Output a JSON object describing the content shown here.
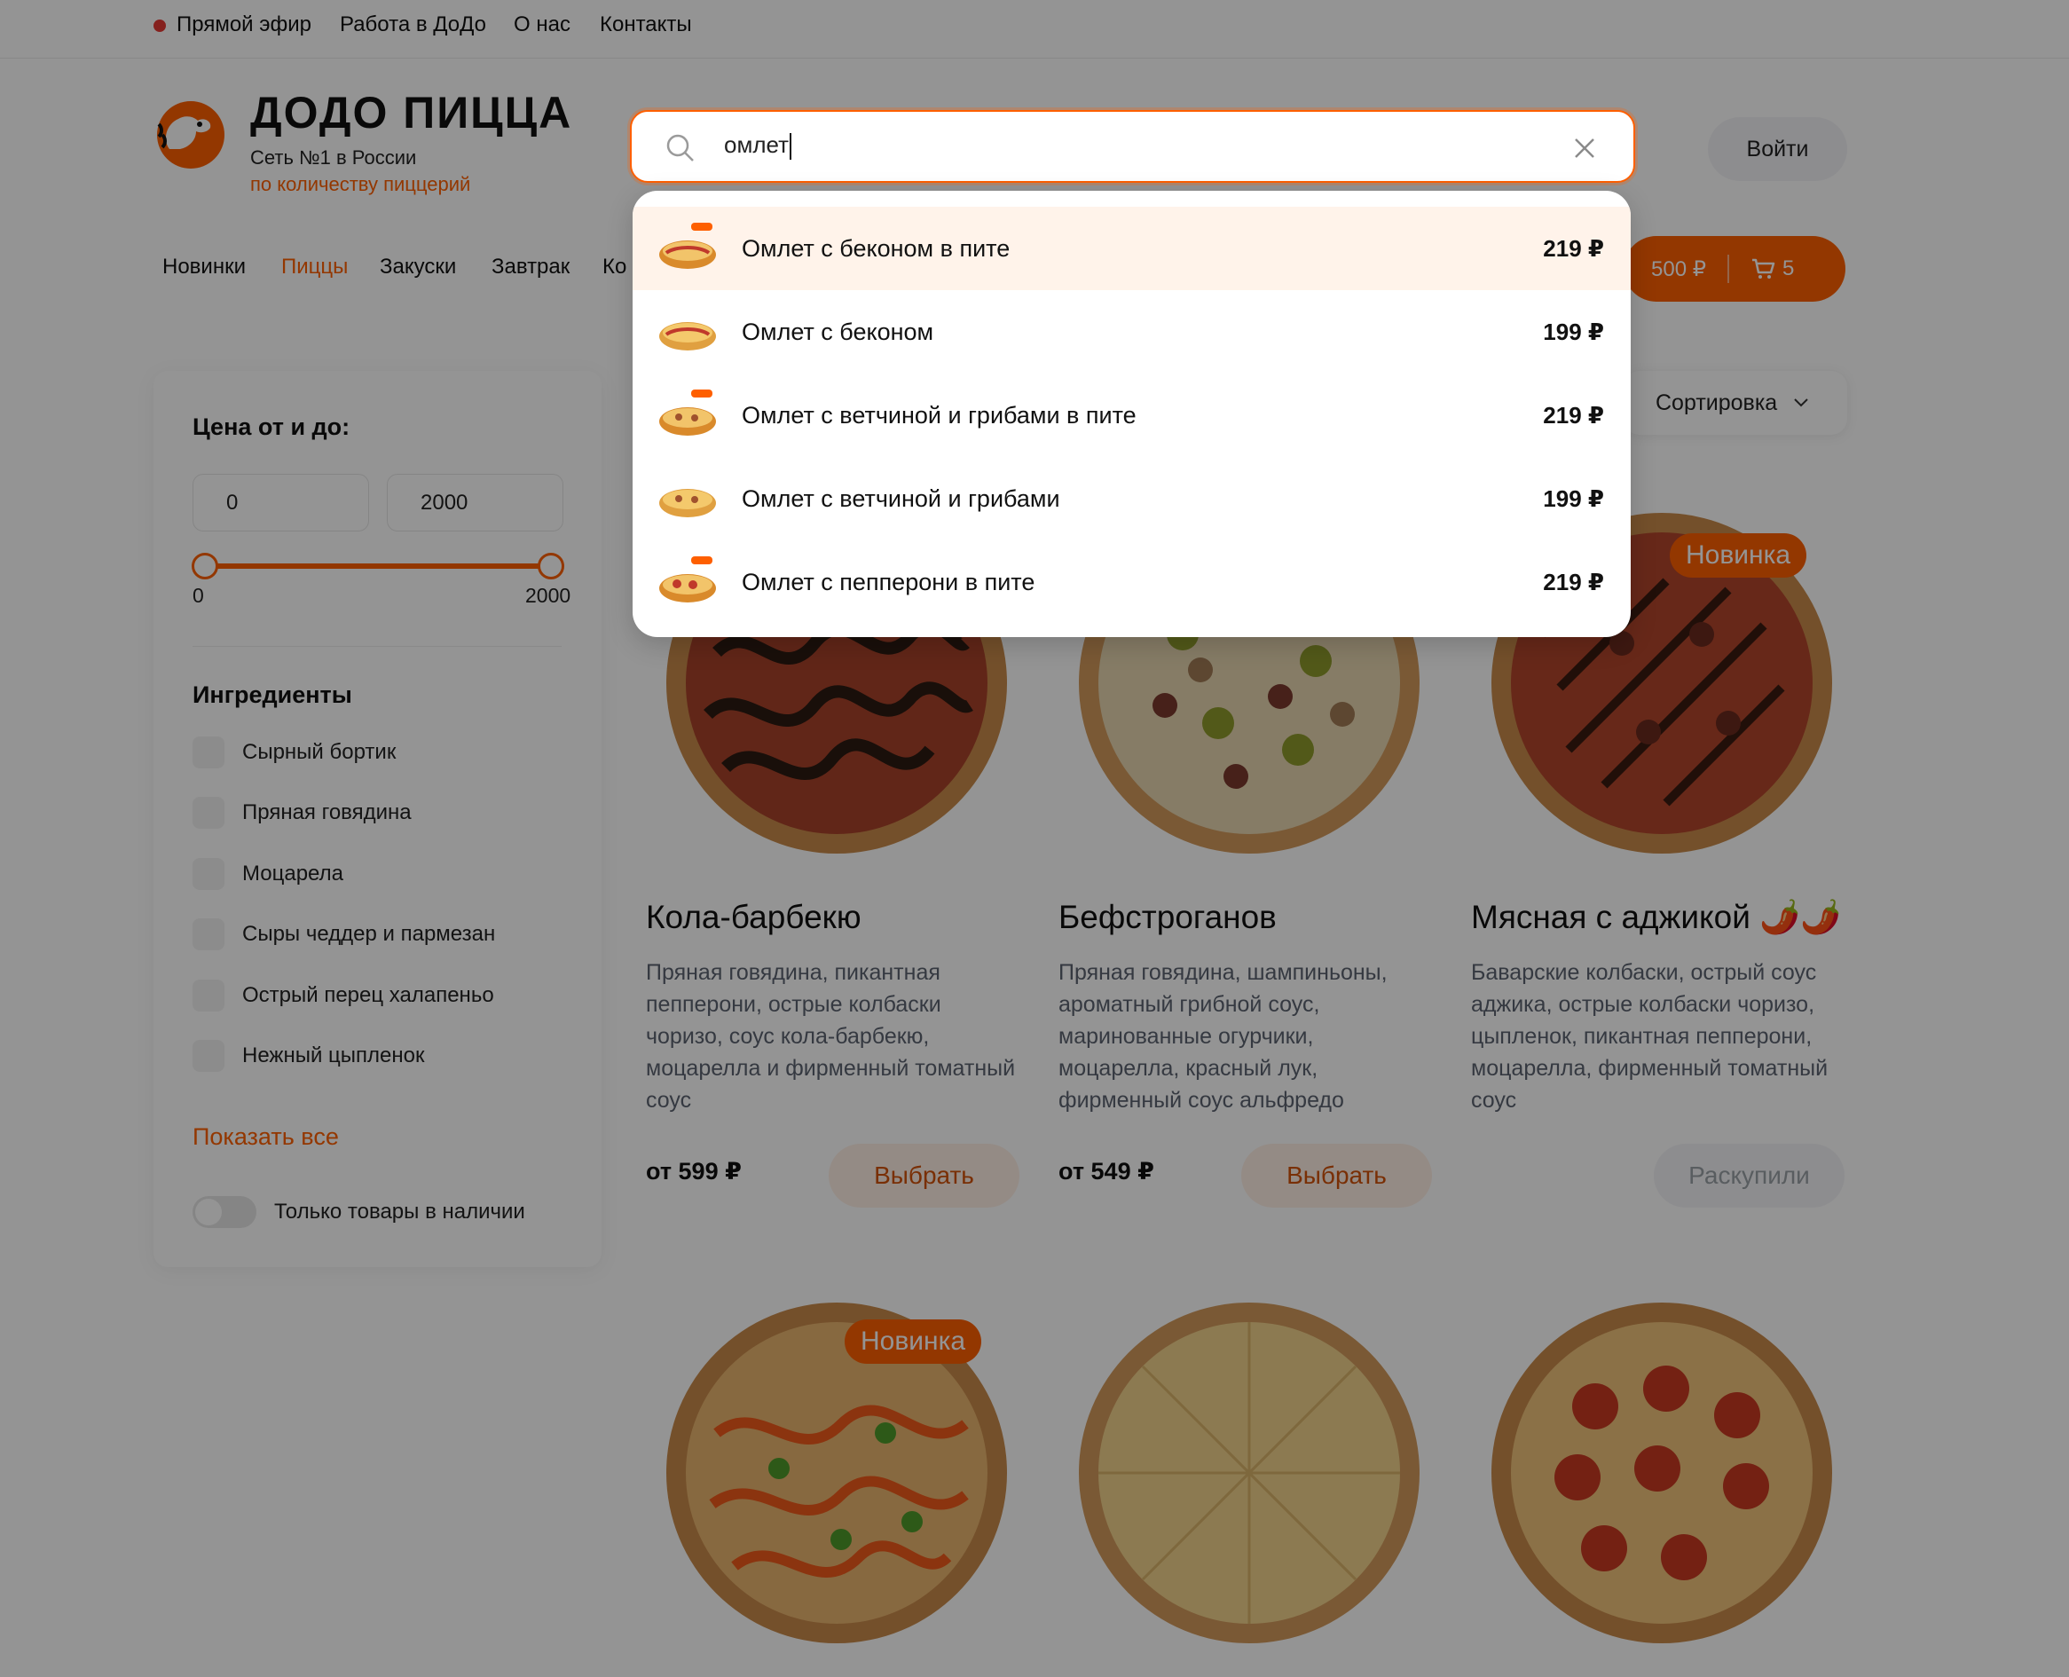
{
  "topbar": {
    "links": [
      "Прямой эфир",
      "Работа в ДоДо",
      "О нас",
      "Контакты"
    ]
  },
  "brand": {
    "title": "ДОДО ПИЦЦА",
    "subtitle1": "Сеть №1 в России",
    "subtitle2": "по количеству пиццерий"
  },
  "header": {
    "login_label": "Войти"
  },
  "search": {
    "value": "омлет",
    "results": [
      {
        "name": "Омлет с беконом в пите",
        "price": "219 ₽",
        "highlighted": true
      },
      {
        "name": "Омлет с беконом",
        "price": "199 ₽",
        "highlighted": false
      },
      {
        "name": "Омлет с ветчиной и грибами в пите",
        "price": "219 ₽",
        "highlighted": false
      },
      {
        "name": "Омлет с ветчиной и грибами",
        "price": "199 ₽",
        "highlighted": false
      },
      {
        "name": "Омлет с пепперони в пите",
        "price": "219 ₽",
        "highlighted": false
      }
    ]
  },
  "nav": {
    "categories": [
      {
        "label": "Новинки",
        "active": false
      },
      {
        "label": "Пиццы",
        "active": true
      },
      {
        "label": "Закуски",
        "active": false
      },
      {
        "label": "Завтрак",
        "active": false
      },
      {
        "label": "Ко",
        "active": false
      }
    ]
  },
  "cart": {
    "sum": "500 ₽",
    "count": "5"
  },
  "filters": {
    "price_title": "Цена от и до:",
    "price_from": "0",
    "price_to": "2000",
    "slider_min_label": "0",
    "slider_max_label": "2000",
    "ingredients_title": "Ингредиенты",
    "ingredients": [
      "Сырный бортик",
      "Пряная говядина",
      "Моцарела",
      "Сыры чеддер и пармезан",
      "Острый перец халапеньо",
      "Нежный цыпленок"
    ],
    "show_all_label": "Показать все",
    "in_stock_label": "Только товары в наличии"
  },
  "sort": {
    "label": "Сортировка"
  },
  "products": [
    {
      "title": "Кола-барбекю",
      "description": "Пряная говядина, пикантная пепперони, острые колбаски чоризо, соус кола-барбекю, моцарелла и фирменный томатный соус",
      "price": "от 599 ₽",
      "button": "Выбрать"
    },
    {
      "title": "Бефстроганов",
      "description": "Пряная говядина, шампиньоны, ароматный грибной соус, маринованные огурчики, моцарелла, красный лук, фирменный соус альфредо",
      "price": "от 549 ₽",
      "button": "Выбрать"
    },
    {
      "title": "Мясная с аджикой 🌶️🌶️",
      "description": "Баварские колбаски, острый соус аджика, острые колбаски чоризо, цыпленок, пикантная пепперони, моцарелла, фирменный томатный соус",
      "badge": "Новинка",
      "button": "Раскупили"
    }
  ],
  "second_row": {
    "badge": "Новинка"
  },
  "colors": {
    "accent": "#fe5f00",
    "overlay": "rgba(0,0,0,0.42)"
  }
}
